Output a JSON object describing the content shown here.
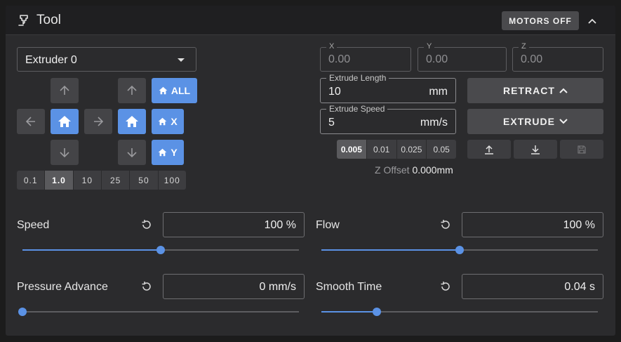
{
  "header": {
    "title": "Tool",
    "motors_off_label": "MOTORS OFF"
  },
  "extruder_select": {
    "value": "Extruder 0"
  },
  "jog": {
    "home_all": "ALL",
    "home_x": "X",
    "home_y": "Y"
  },
  "step_distances": {
    "options": [
      "0.1",
      "1.0",
      "10",
      "25",
      "50",
      "100"
    ],
    "selected": "1.0"
  },
  "coordinates": [
    {
      "label": "X",
      "value": "0.00"
    },
    {
      "label": "Y",
      "value": "0.00"
    },
    {
      "label": "Z",
      "value": "0.00"
    }
  ],
  "extrude_length": {
    "label": "Extrude Length",
    "value": "10",
    "unit": "mm"
  },
  "extrude_speed": {
    "label": "Extrude Speed",
    "value": "5",
    "unit": "mm/s"
  },
  "retract_label": "RETRACT",
  "extrude_label": "EXTRUDE",
  "z_steps": {
    "options": [
      "0.005",
      "0.01",
      "0.025",
      "0.05"
    ],
    "selected": "0.005"
  },
  "z_offset": {
    "label": "Z Offset",
    "value": "0.000mm"
  },
  "sliders": {
    "speed": {
      "label": "Speed",
      "value": "100 %",
      "fraction": 0.5
    },
    "flow": {
      "label": "Flow",
      "value": "100 %",
      "fraction": 0.5
    },
    "pressure_advance": {
      "label": "Pressure Advance",
      "value": "0 mm/s",
      "fraction": 0.0
    },
    "smooth_time": {
      "label": "Smooth Time",
      "value": "0.04 s",
      "fraction": 0.2
    }
  },
  "colors": {
    "accent": "#5b92e5",
    "button": "#4a4a4d",
    "card": "#2b2b2d"
  }
}
